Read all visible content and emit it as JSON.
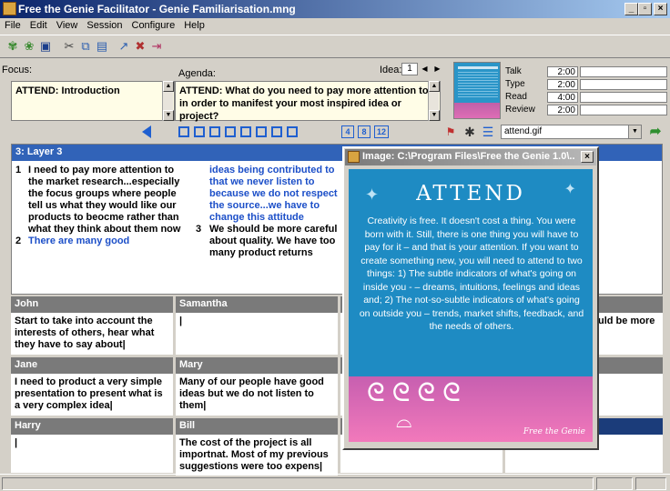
{
  "window": {
    "title": "Free the Genie Facilitator - Genie Familiarisation.mng"
  },
  "menu": [
    "File",
    "Edit",
    "View",
    "Session",
    "Configure",
    "Help"
  ],
  "focus": {
    "label": "Focus:",
    "text": "ATTEND: Introduction"
  },
  "agenda": {
    "label": "Agenda:",
    "text": "ATTEND: What do you need to pay more attention to in order to manifest your most inspired idea or project?"
  },
  "idea": {
    "label": "Idea:",
    "value": "1"
  },
  "timers": [
    {
      "label": "Talk",
      "value": "2:00"
    },
    {
      "label": "Type",
      "value": "2:00"
    },
    {
      "label": "Read",
      "value": "4:00"
    },
    {
      "label": "Review",
      "value": "2:00"
    }
  ],
  "layout_buttons": [
    "4",
    "8",
    "12"
  ],
  "image_select": {
    "value": "attend.gif"
  },
  "layer": {
    "title": "3: Layer 3",
    "col1": [
      {
        "num": "1",
        "text": "I need to pay more attention to the market research...especially the focus groups where people tell us what they would like our products to beocme rather than what they think about them now",
        "color": "#000000"
      },
      {
        "num": "2",
        "text": "There are many good",
        "color": "#1c4fc8"
      }
    ],
    "col2_cont": "ideas being contributed to that we never listen to because we do not respect the source...we have to change this attitude",
    "col2_items": [
      {
        "num": "3",
        "text": "We should be more careful about quality. We have too many product returns",
        "color": "#000000"
      }
    ]
  },
  "participants": [
    {
      "name": "John",
      "text": "Start to take into account the interests of others, hear what they have to say about"
    },
    {
      "name": "Samantha",
      "text": ""
    },
    {
      "name": "Jane",
      "text": "I need to product a very simple presentation to present what is a very complex idea"
    },
    {
      "name": "Mary",
      "text": "Many of our people have good ideas but we do not listen to them"
    },
    {
      "name": "Harry",
      "text": ""
    },
    {
      "name": "Bill",
      "text": "The cost of the project is all importnat. Most of my previous suggestions were too expens"
    }
  ],
  "hidden_fragment": "uld be more",
  "image_window": {
    "title": "Image: C:\\Program Files\\Free the Genie 1.0\\...",
    "card_title": "ATTEND",
    "card_text": "Creativity is free. It doesn't cost a thing. You were born with it. Still, there is one thing you will have to pay for it – and that is your attention. If you want to create something new, you will need to attend to two things: 1) The subtle indicators of what's going on inside you - – dreams, intuitions, feelings and ideas and; 2) The not-so-subtle indicators of what's going on outside you – trends, market shifts, feedback, and the needs of others.",
    "brand": "Free the Genie"
  },
  "colors": {
    "title_start": "#0a246a",
    "card_bg": "#1e8bc3",
    "header_gray": "#7a7a7a",
    "link_blue": "#1c4fc8"
  }
}
